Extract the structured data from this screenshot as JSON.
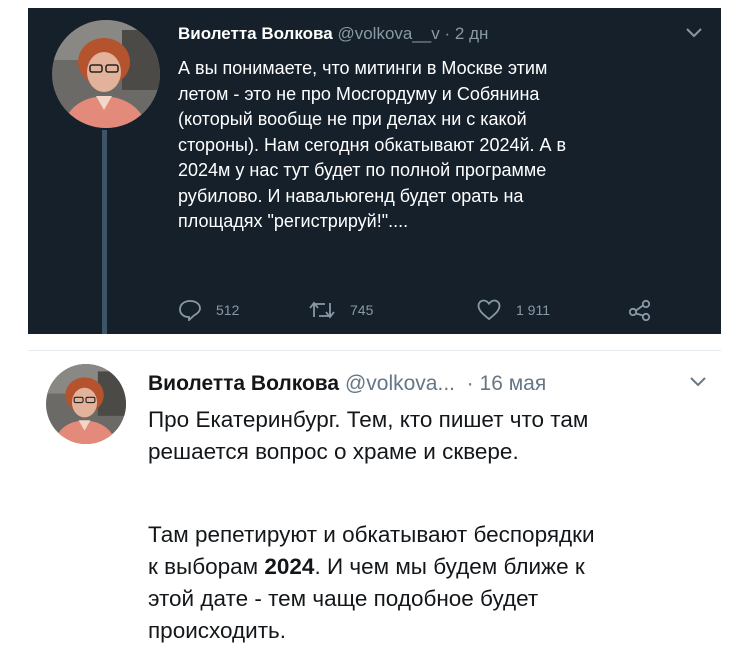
{
  "tweet_top": {
    "author_name": "Виолетта Волкова",
    "handle": "@volkova__v",
    "separator": "·",
    "time": "2 дн",
    "text_lines": [
      "А вы понимаете, что митинги в Москве этим",
      "летом - это не про Мосгордуму и Собянина",
      "(который вообще не при делах ни с какой",
      "стороны). Нам сегодня обкатывают 2024й. А в",
      "2024м у нас тут будет по полной программе",
      "рубилово. И навальюгенд будет орать  на",
      "площадях \"регистрируй!\"...."
    ],
    "actions": {
      "replies": "512",
      "retweets": "745",
      "likes": "1 911"
    },
    "colors": {
      "background": "#15202b",
      "text": "#ffffff",
      "muted": "#8899a6",
      "thread_line": "#3d5466"
    }
  },
  "tweet_bottom": {
    "author_name": "Виолетта Волкова",
    "handle": "@volkova...",
    "separator": "·",
    "time": "16 мая",
    "paragraph1_lines": [
      "Про Екатеринбург. Тем, кто пишет что там",
      "решается вопрос о храме и сквере."
    ],
    "paragraph2_line1": "Там репетируют и обкатывают беспорядки",
    "paragraph2_line2_before": "к выборам ",
    "paragraph2_line2_bold": "2024",
    "paragraph2_line2_after": ". И чем мы будем ближе к",
    "paragraph2_lines_rest": [
      "этой дате - тем чаще подобное будет",
      "происходить."
    ],
    "colors": {
      "background": "#ffffff",
      "text": "#14171a",
      "muted": "#657786"
    }
  },
  "icons": [
    "avatar-photo",
    "chevron-down-icon",
    "reply-icon",
    "retweet-icon",
    "like-icon",
    "share-icon"
  ]
}
